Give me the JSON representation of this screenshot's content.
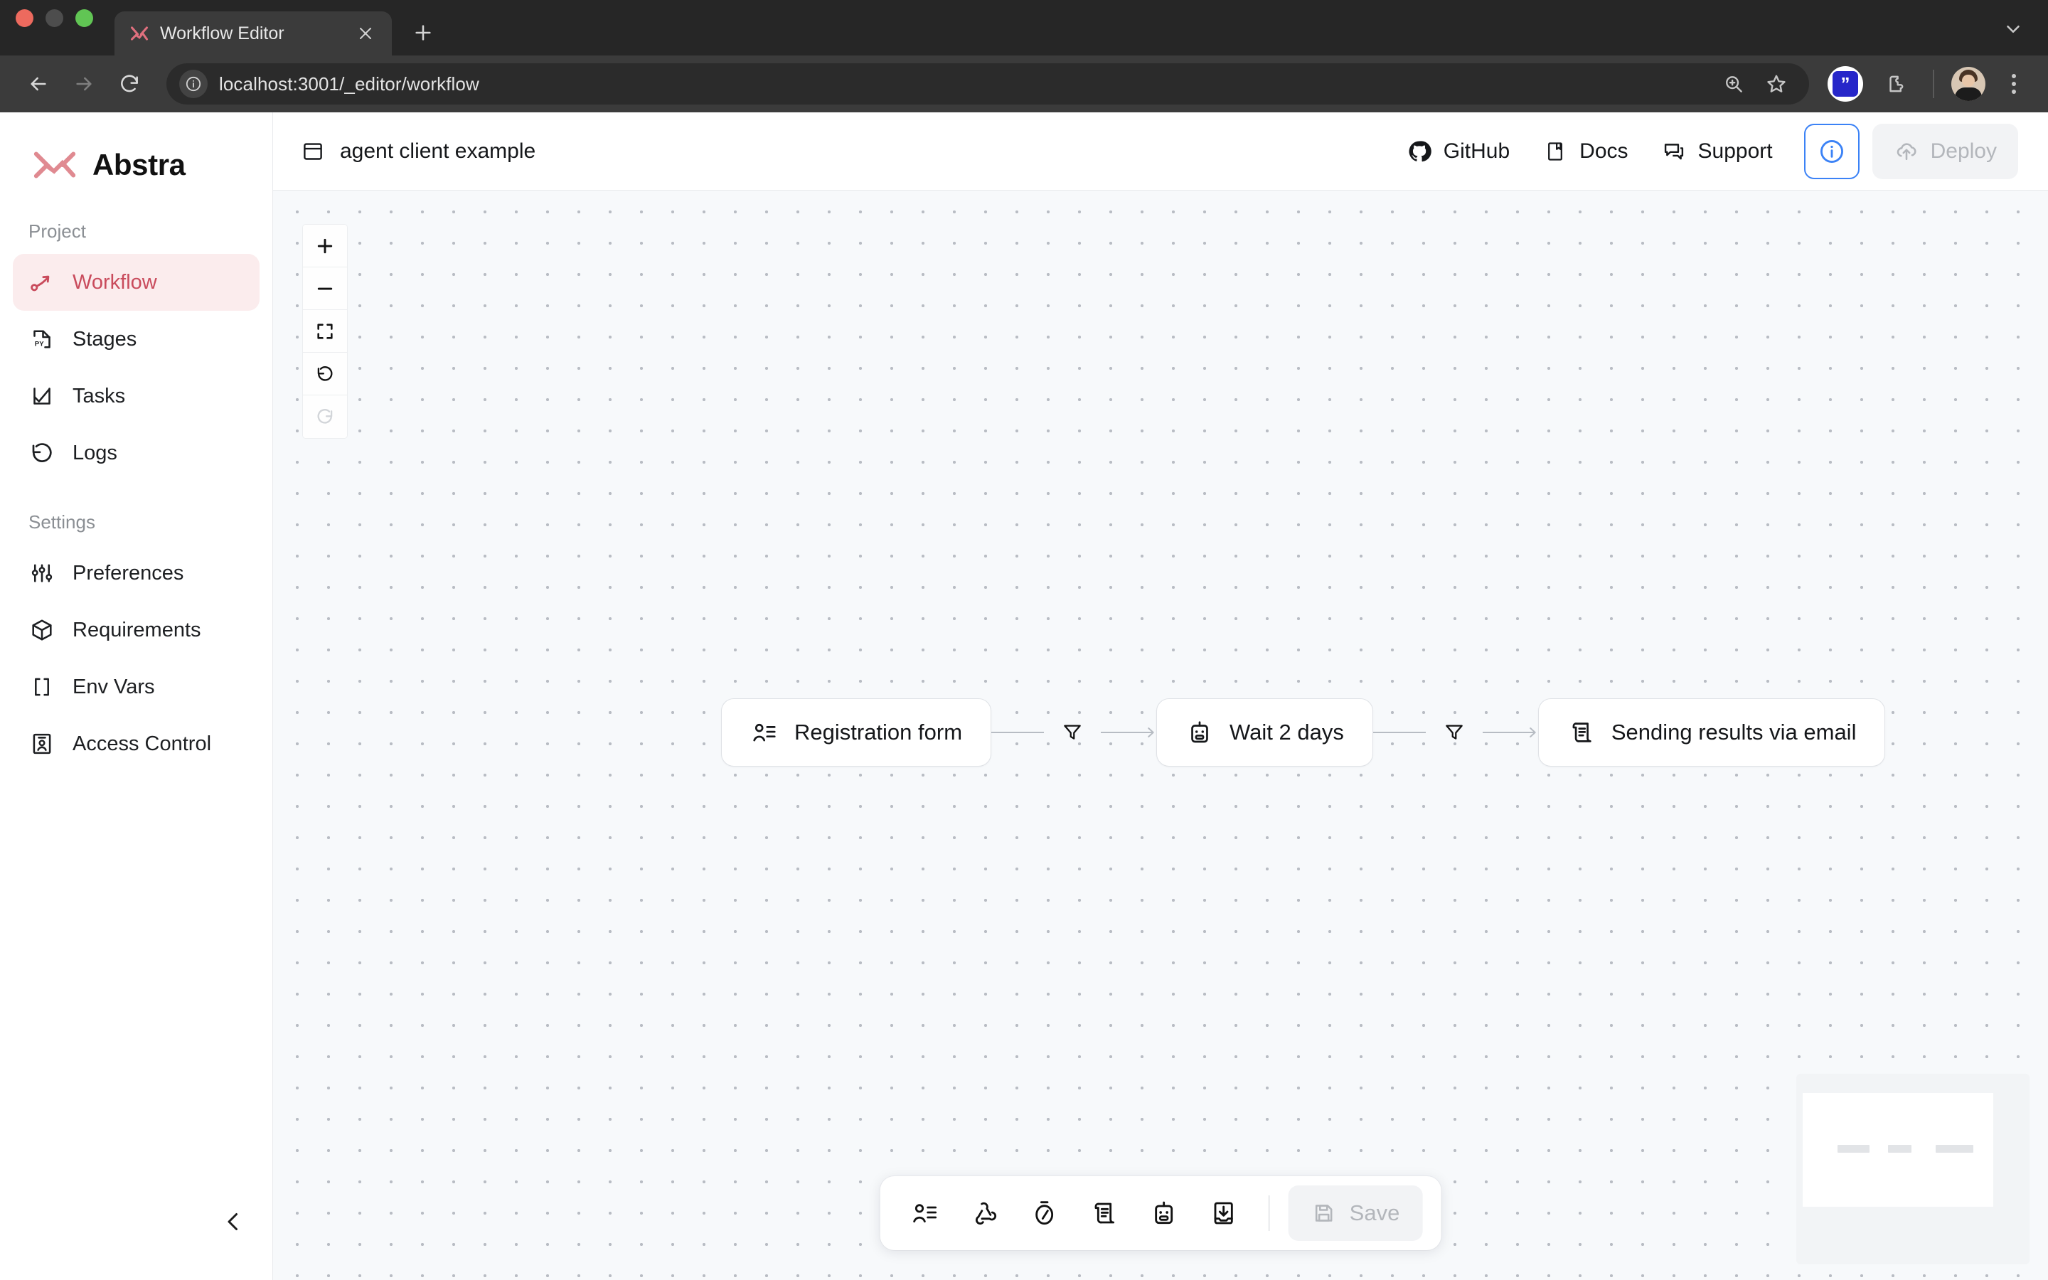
{
  "browser": {
    "tab": {
      "title": "Workflow Editor",
      "favicon_icon": "abstra-logo-icon",
      "close_icon": "close-icon"
    },
    "new_tab_label": "+",
    "tabstrip_menu_icon": "chevron-down-icon",
    "nav": {
      "back_icon": "back-arrow-icon",
      "forward_icon": "forward-arrow-icon",
      "reload_icon": "reload-icon",
      "site_info_icon": "info-circle-icon",
      "url": "localhost:3001/_editor/workflow",
      "zoom_icon": "zoom-search-icon",
      "bookmark_icon": "star-icon",
      "extension_badge_text": "”",
      "extensions_icon": "puzzle-piece-icon",
      "avatar_icon": "profile-avatar",
      "menu_icon": "kebab-menu-icon"
    }
  },
  "sidebar": {
    "brand": {
      "name": "Abstra",
      "logo_icon": "abstra-logo-icon"
    },
    "collapse_icon": "chevron-left-icon",
    "sections": [
      {
        "label": "Project",
        "items": [
          {
            "label": "Workflow",
            "icon": "workflow-path-icon",
            "active": true
          },
          {
            "label": "Stages",
            "icon": "python-file-icon",
            "active": false
          },
          {
            "label": "Tasks",
            "icon": "check-square-icon",
            "active": false
          },
          {
            "label": "Logs",
            "icon": "history-undo-icon",
            "active": false
          }
        ]
      },
      {
        "label": "Settings",
        "items": [
          {
            "label": "Preferences",
            "icon": "sliders-icon",
            "active": false
          },
          {
            "label": "Requirements",
            "icon": "package-box-icon",
            "active": false
          },
          {
            "label": "Env Vars",
            "icon": "brackets-icon",
            "active": false
          },
          {
            "label": "Access Control",
            "icon": "id-badge-icon",
            "active": false
          }
        ]
      }
    ]
  },
  "topbar": {
    "workflow_title": "agent client example",
    "workflow_icon": "window-panel-icon",
    "links": [
      {
        "label": "GitHub",
        "icon": "github-icon"
      },
      {
        "label": "Docs",
        "icon": "book-icon"
      },
      {
        "label": "Support",
        "icon": "chat-bubbles-icon"
      }
    ],
    "info_button_icon": "info-circle-icon",
    "deploy": {
      "label": "Deploy",
      "icon": "cloud-upload-icon",
      "disabled": true
    }
  },
  "canvas": {
    "zoom_controls": [
      {
        "name": "zoom-in",
        "icon": "plus-icon",
        "disabled": false
      },
      {
        "name": "zoom-out",
        "icon": "minus-icon",
        "disabled": false
      },
      {
        "name": "fit-view",
        "icon": "fit-screen-icon",
        "disabled": false
      },
      {
        "name": "undo",
        "icon": "undo-icon",
        "disabled": false
      },
      {
        "name": "redo",
        "icon": "redo-icon",
        "disabled": true
      }
    ],
    "nodes": [
      {
        "label": "Registration form",
        "icon": "form-person-icon"
      },
      {
        "label": "Wait 2 days",
        "icon": "bot-icon"
      },
      {
        "label": "Sending results via email",
        "icon": "script-scroll-icon"
      }
    ],
    "edges": [
      {
        "condition_icon": "filter-funnel-icon"
      },
      {
        "condition_icon": "filter-funnel-icon"
      }
    ],
    "minimap": {
      "node_widths": [
        45,
        33,
        53
      ],
      "node_lefts": [
        49,
        119,
        187
      ]
    }
  },
  "bottom_toolbar": {
    "tools": [
      {
        "name": "add-form-stage",
        "icon": "form-person-icon"
      },
      {
        "name": "add-hook-stage",
        "icon": "webhook-icon"
      },
      {
        "name": "add-job-stage",
        "icon": "stopwatch-icon"
      },
      {
        "name": "add-script-stage",
        "icon": "script-scroll-icon"
      },
      {
        "name": "add-agent-stage",
        "icon": "bot-icon"
      },
      {
        "name": "add-iterator-stage",
        "icon": "inbox-download-icon"
      }
    ],
    "save": {
      "label": "Save",
      "icon": "floppy-save-icon",
      "disabled": true
    }
  },
  "colors": {
    "accent": "#c94b5c",
    "accent_soft": "#fbeced",
    "logo": "#e08a91",
    "info_blue": "#3b82f6",
    "canvas_bg": "#f7f9fb",
    "chrome_dark": "#3b3b3b"
  }
}
